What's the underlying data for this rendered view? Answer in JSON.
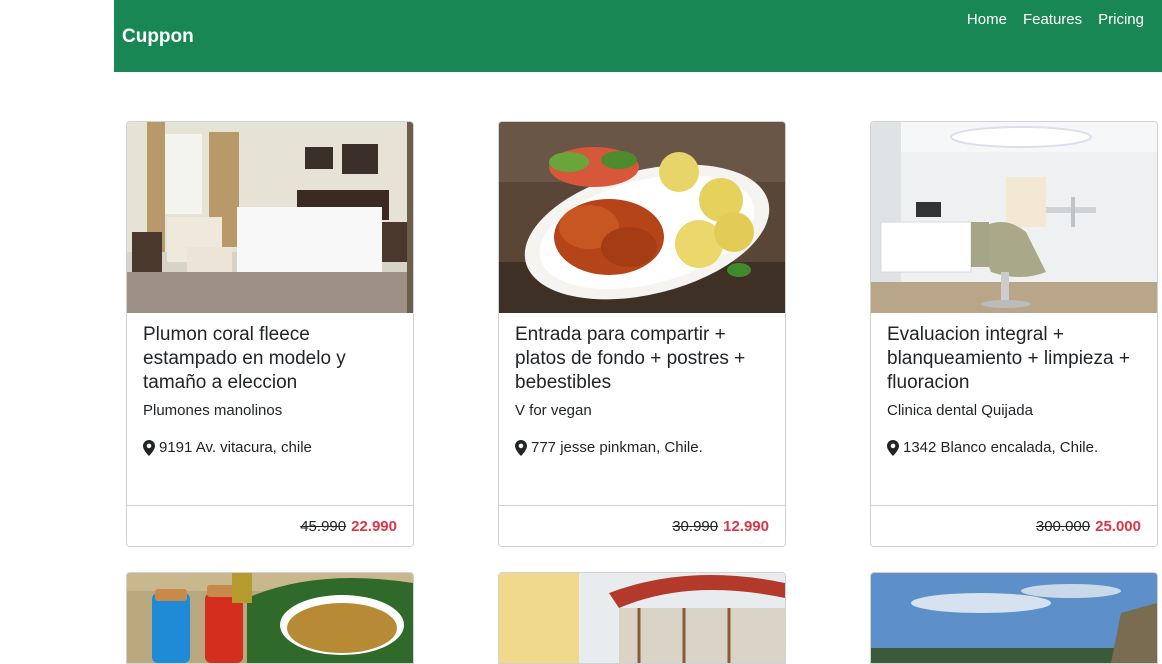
{
  "navbar": {
    "brand": "Cuppon",
    "links": [
      "Home",
      "Features",
      "Pricing"
    ]
  },
  "cards": [
    {
      "title": "Plumon coral fleece estampado en modelo y tamaño a eleccion",
      "subtitle": "Plumones manolinos",
      "location": "9191 Av. vitacura, chile",
      "old_price": "45.990",
      "new_price": "22.990",
      "image": "hotel-bedroom"
    },
    {
      "title": "Entrada para compartir + platos de fondo + postres + bebestibles",
      "subtitle": "V for vegan",
      "location": "777 jesse pinkman, Chile.",
      "old_price": "30.990",
      "new_price": "12.990",
      "image": "food-plate"
    },
    {
      "title": "Evaluacion integral + blanqueamiento + limpieza + fluoracion",
      "subtitle": "Clinica dental Quijada",
      "location": "1342 Blanco encalada, Chile.",
      "old_price": "300.000",
      "new_price": "25.000",
      "image": "dental-clinic"
    }
  ],
  "bottom_cards": [
    "soup-jars",
    "carousel-ride",
    "sky-landscape"
  ],
  "colors": {
    "navbar": "#198754",
    "price_new": "#dc3545"
  }
}
